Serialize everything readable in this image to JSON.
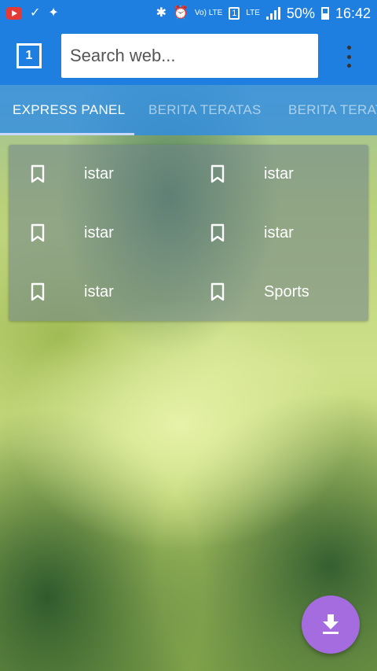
{
  "status_bar": {
    "network": "LTE",
    "volte": "Vo) LTE",
    "sim": "1",
    "battery": "50%",
    "time": "16:42"
  },
  "toolbar": {
    "tab_count": "1",
    "search_placeholder": "Search web..."
  },
  "tabs": [
    {
      "label": "EXPRESS PANEL"
    },
    {
      "label": "BERITA TERATAS"
    },
    {
      "label": "BERITA TERATAS"
    }
  ],
  "express_panel": {
    "items": [
      {
        "label": "istar",
        "icon": "bookmark-icon"
      },
      {
        "label": "istar",
        "icon": "bookmark-icon"
      },
      {
        "label": "istar",
        "icon": "bookmark-icon"
      },
      {
        "label": "istar",
        "icon": "bookmark-icon"
      },
      {
        "label": "istar",
        "icon": "bookmark-icon"
      },
      {
        "label": "Sports",
        "icon": "bookmark-icon"
      }
    ]
  },
  "fab": {
    "icon": "download-icon",
    "color": "#a46cde"
  },
  "colors": {
    "primary": "#1f7fe0",
    "accent": "#a46cde"
  }
}
